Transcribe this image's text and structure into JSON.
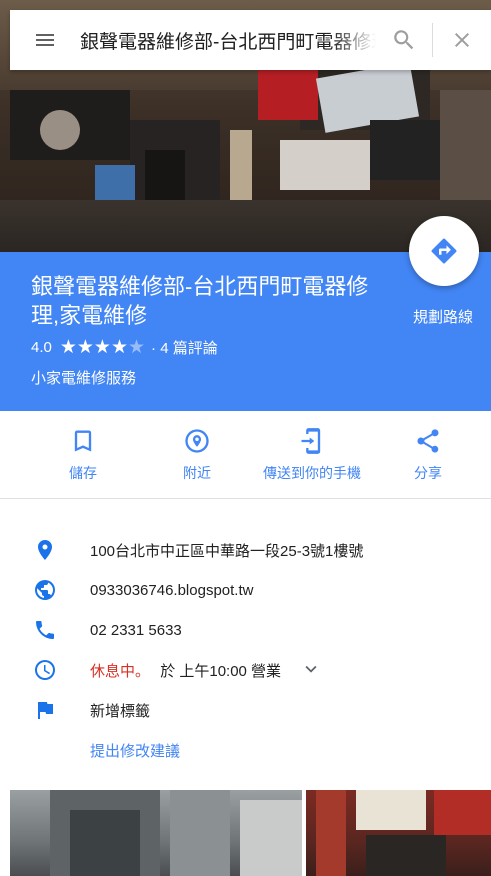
{
  "search": {
    "query": "銀聲電器維修部-台北西門町電器修理,家電維修"
  },
  "place": {
    "name": "銀聲電器維修部-台北西門町電器修理,家電維修",
    "rating": "4.0",
    "stars_filled": 4,
    "reviews": "· 4 篇評論",
    "category": "小家電維修服務",
    "directions_label": "規劃路線"
  },
  "actions": [
    {
      "label": "儲存",
      "icon": "bookmark-icon"
    },
    {
      "label": "附近",
      "icon": "nearby-icon"
    },
    {
      "label": "傳送到你的手機",
      "icon": "send-to-phone-icon"
    },
    {
      "label": "分享",
      "icon": "share-icon"
    }
  ],
  "info": {
    "address": "100台北市中正區中華路一段25-3號1樓號",
    "website": "0933036746.blogspot.tw",
    "phone": "02 2331 5633",
    "hours_status": "休息中。",
    "hours_detail": "於 上午10:00 營業",
    "add_label": "新增標籤",
    "suggest_edit": "提出修改建議"
  },
  "colors": {
    "accent": "#4285f4",
    "closed": "#d93025",
    "icon": "#1a73e8",
    "text": "#212121"
  }
}
